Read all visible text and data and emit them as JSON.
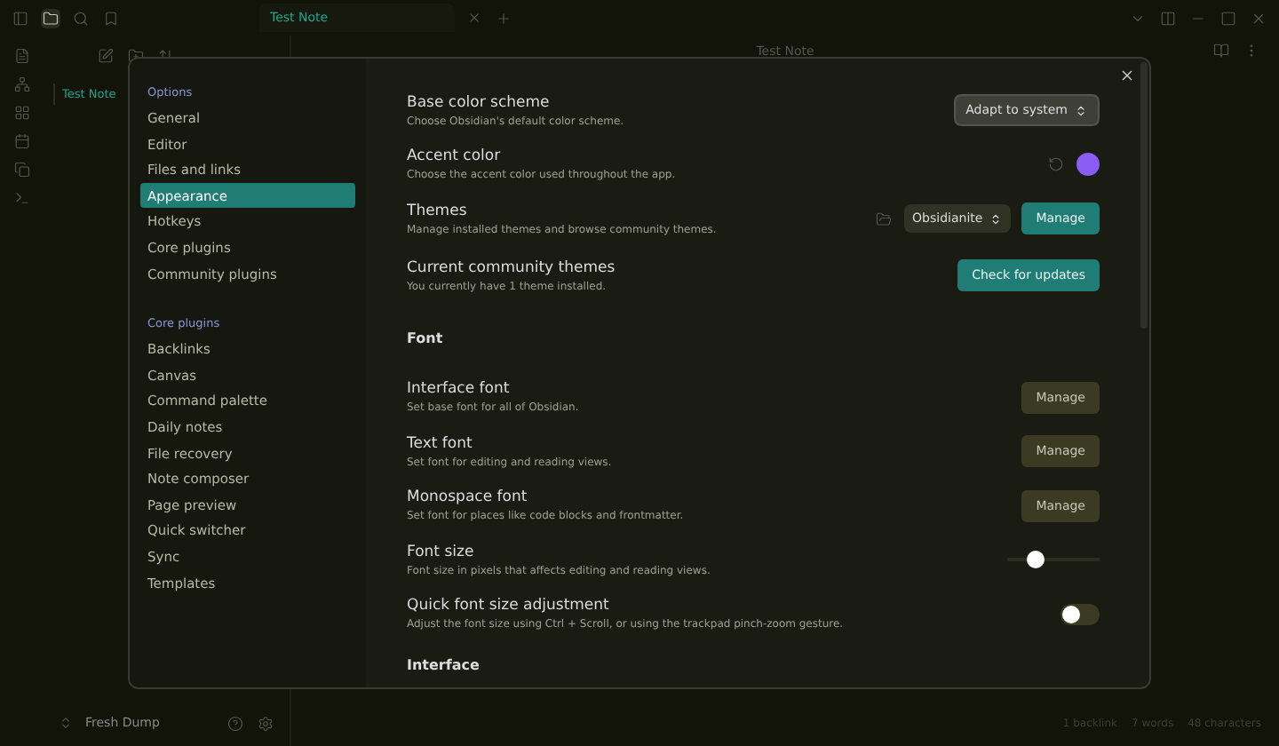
{
  "tabs": [
    {
      "label": "Test Note",
      "selected": true
    }
  ],
  "file_tree": [
    {
      "label": "Test Note",
      "selected": true
    }
  ],
  "note_title": "Test Note",
  "vault": {
    "name": "Fresh Dump"
  },
  "status_bar": [
    "1 backlink",
    "7 words",
    "48 characters"
  ],
  "settings": {
    "nav": [
      {
        "heading": "Options",
        "items": [
          {
            "label": "General",
            "selected": false
          },
          {
            "label": "Editor",
            "selected": false
          },
          {
            "label": "Files and links",
            "selected": false
          },
          {
            "label": "Appearance",
            "selected": true
          },
          {
            "label": "Hotkeys",
            "selected": false
          },
          {
            "label": "Core plugins",
            "selected": false
          },
          {
            "label": "Community plugins",
            "selected": false
          }
        ]
      },
      {
        "heading": "Core plugins",
        "items": [
          {
            "label": "Backlinks",
            "selected": false
          },
          {
            "label": "Canvas",
            "selected": false
          },
          {
            "label": "Command palette",
            "selected": false
          },
          {
            "label": "Daily notes",
            "selected": false
          },
          {
            "label": "File recovery",
            "selected": false
          },
          {
            "label": "Note composer",
            "selected": false
          },
          {
            "label": "Page preview",
            "selected": false
          },
          {
            "label": "Quick switcher",
            "selected": false
          },
          {
            "label": "Sync",
            "selected": false
          },
          {
            "label": "Templates",
            "selected": false
          }
        ]
      }
    ],
    "rows": [
      {
        "kind": "dropdown",
        "title": "Base color scheme",
        "description": "Choose Obsidian's default color scheme.",
        "value": "Adapt to system"
      },
      {
        "kind": "color",
        "title": "Accent color",
        "description": "Choose the accent color used throughout the app.",
        "color": "#8a5cf5"
      },
      {
        "kind": "theme",
        "title": "Themes",
        "description": "Manage installed themes and browse community themes.",
        "value": "Obsidianite",
        "button": "Manage"
      },
      {
        "kind": "button",
        "title": "Current community themes",
        "description": "You currently have 1 theme installed.",
        "button": "Check for updates",
        "primary": true
      },
      {
        "kind": "heading",
        "title": "Font"
      },
      {
        "kind": "button",
        "title": "Interface font",
        "description": "Set base font for all of Obsidian.",
        "button": "Manage",
        "primary": false
      },
      {
        "kind": "button",
        "title": "Text font",
        "description": "Set font for editing and reading views.",
        "button": "Manage",
        "primary": false
      },
      {
        "kind": "button",
        "title": "Monospace font",
        "description": "Set font for places like code blocks and frontmatter.",
        "button": "Manage",
        "primary": false
      },
      {
        "kind": "slider",
        "title": "Font size",
        "description": "Font size in pixels that affects editing and reading views.",
        "level": 0.3
      },
      {
        "kind": "toggle",
        "title": "Quick font size adjustment",
        "description": "Adjust the font size using Ctrl + Scroll, or using the trackpad pinch-zoom gesture.",
        "on": false
      },
      {
        "kind": "heading",
        "title": "Interface"
      }
    ]
  }
}
